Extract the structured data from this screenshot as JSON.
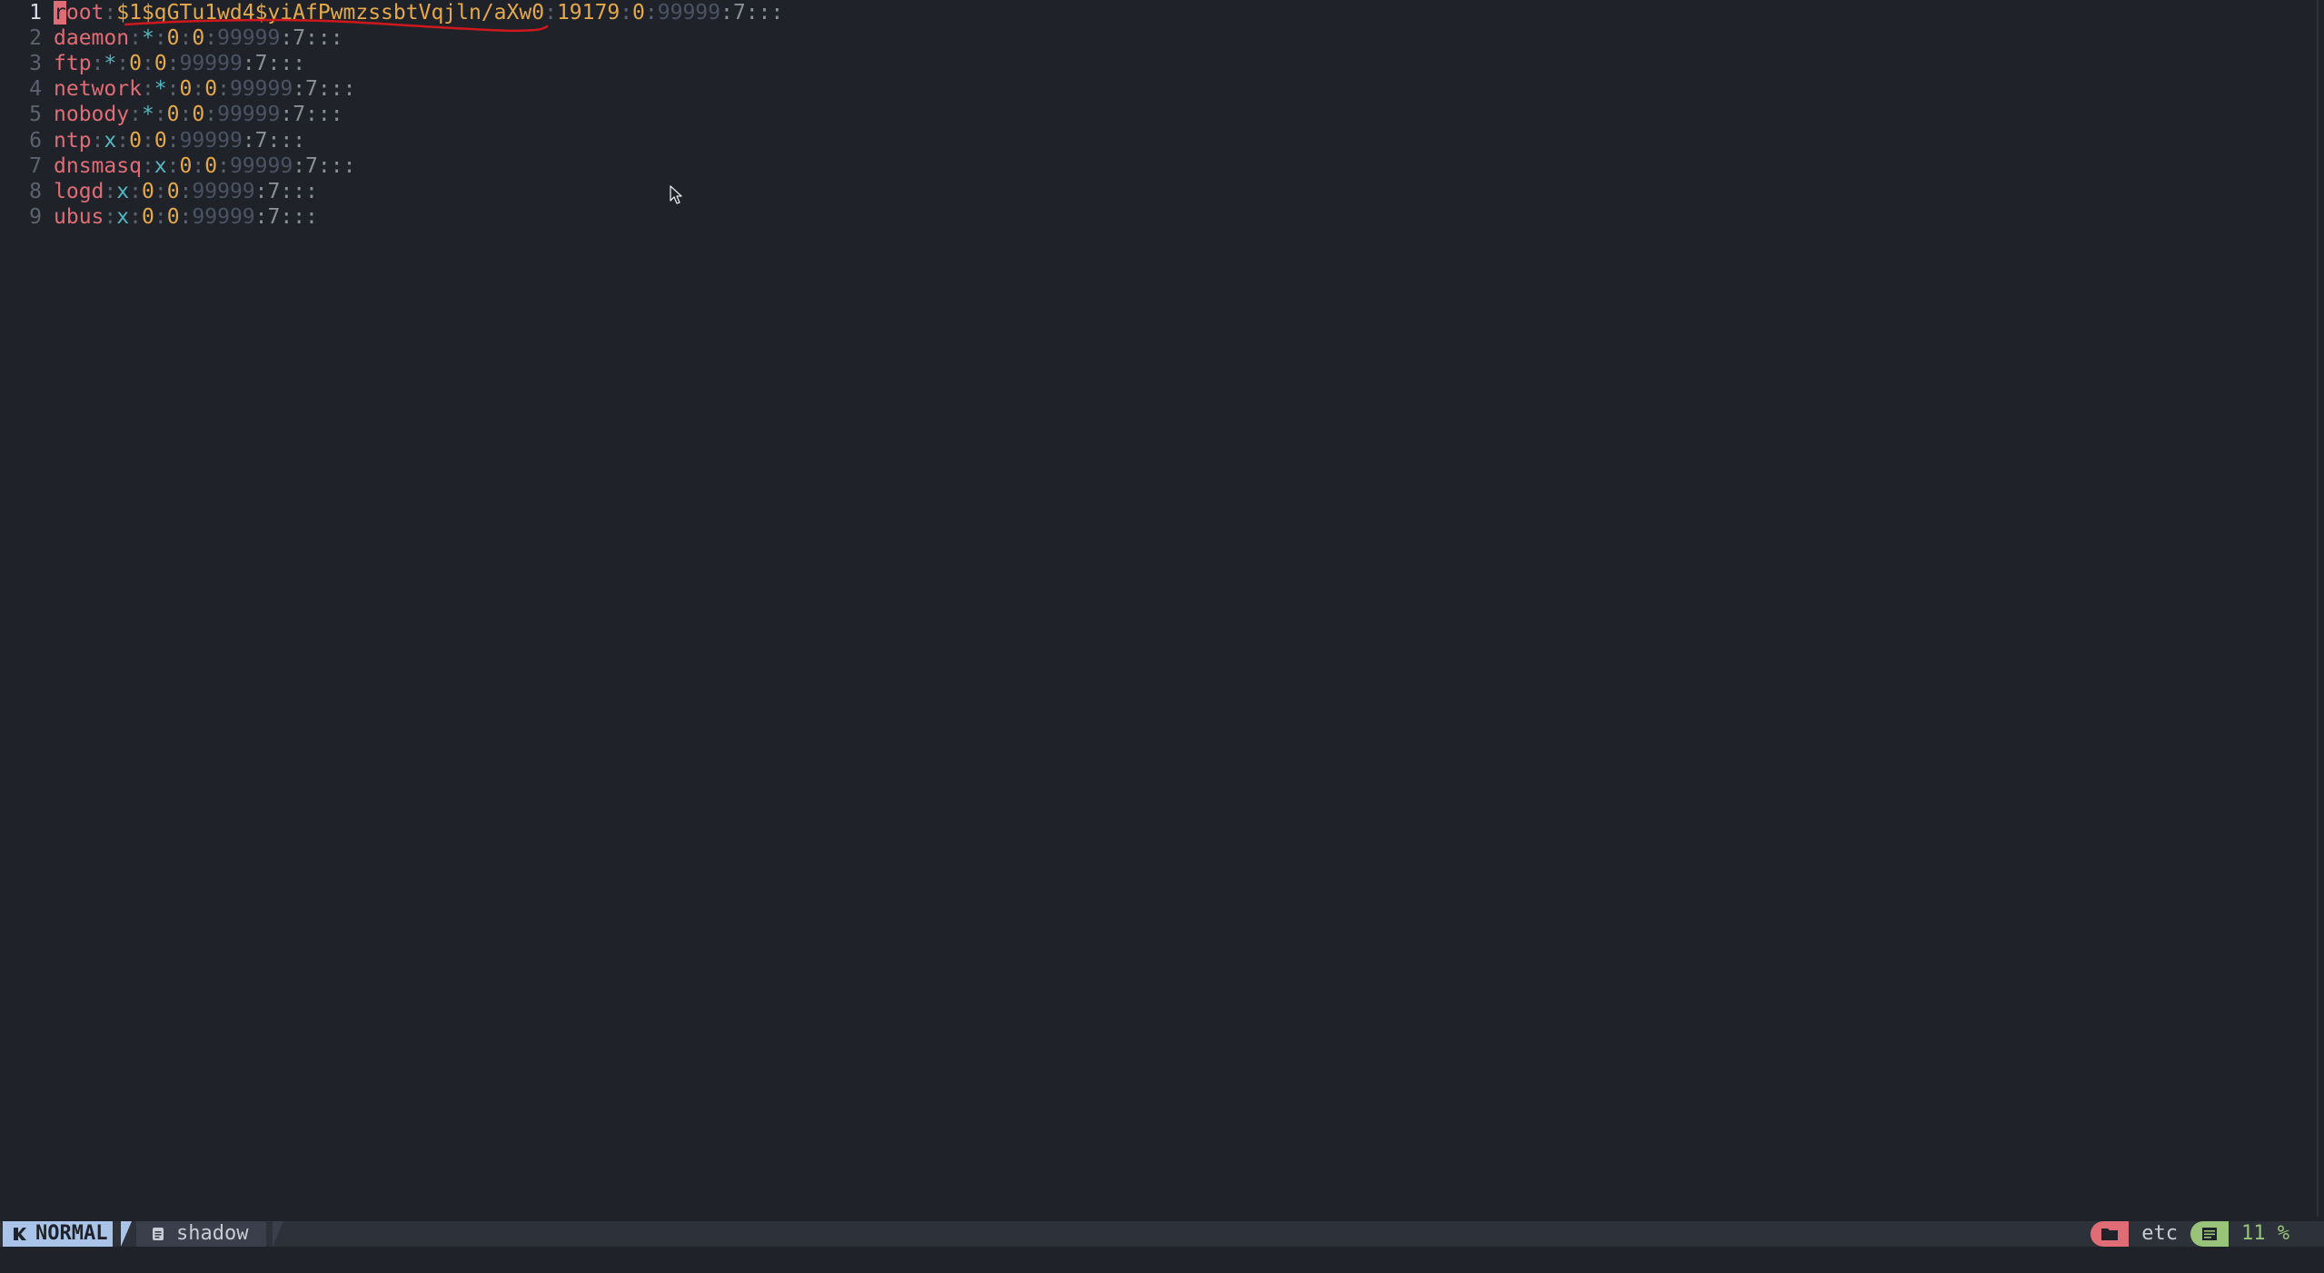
{
  "editor": {
    "lines": [
      {
        "num": "1",
        "segments": [
          {
            "text": "r",
            "color": "#e06c75",
            "cursor": true
          },
          {
            "text": "oot",
            "color": "#e06c75"
          },
          {
            "text": ":",
            "color": "#5c6370"
          },
          {
            "text": "$1$gGTu1wd4$yiAfPwmzssbtVqjln/aXw0",
            "color": "#e5a84b"
          },
          {
            "text": ":",
            "color": "#5c6370"
          },
          {
            "text": "19179",
            "color": "#e5a84b"
          },
          {
            "text": ":",
            "color": "#5c6370"
          },
          {
            "text": "0",
            "color": "#e5a84b"
          },
          {
            "text": ":",
            "color": "#5c6370"
          },
          {
            "text": "99999",
            "color": "#4b5263"
          },
          {
            "text": ":7:::",
            "color": "#8a909a"
          }
        ]
      },
      {
        "num": "2",
        "segments": [
          {
            "text": "daemon",
            "color": "#e06c75"
          },
          {
            "text": ":",
            "color": "#5c6370"
          },
          {
            "text": "*",
            "color": "#56b6c2"
          },
          {
            "text": ":",
            "color": "#5c6370"
          },
          {
            "text": "0",
            "color": "#e5a84b"
          },
          {
            "text": ":",
            "color": "#5c6370"
          },
          {
            "text": "0",
            "color": "#e5a84b"
          },
          {
            "text": ":",
            "color": "#5c6370"
          },
          {
            "text": "99999",
            "color": "#4b5263"
          },
          {
            "text": ":7:::",
            "color": "#8a909a"
          }
        ]
      },
      {
        "num": "3",
        "segments": [
          {
            "text": "ftp",
            "color": "#e06c75"
          },
          {
            "text": ":",
            "color": "#5c6370"
          },
          {
            "text": "*",
            "color": "#56b6c2"
          },
          {
            "text": ":",
            "color": "#5c6370"
          },
          {
            "text": "0",
            "color": "#e5a84b"
          },
          {
            "text": ":",
            "color": "#5c6370"
          },
          {
            "text": "0",
            "color": "#e5a84b"
          },
          {
            "text": ":",
            "color": "#5c6370"
          },
          {
            "text": "99999",
            "color": "#4b5263"
          },
          {
            "text": ":7:::",
            "color": "#8a909a"
          }
        ]
      },
      {
        "num": "4",
        "segments": [
          {
            "text": "network",
            "color": "#e06c75"
          },
          {
            "text": ":",
            "color": "#5c6370"
          },
          {
            "text": "*",
            "color": "#56b6c2"
          },
          {
            "text": ":",
            "color": "#5c6370"
          },
          {
            "text": "0",
            "color": "#e5a84b"
          },
          {
            "text": ":",
            "color": "#5c6370"
          },
          {
            "text": "0",
            "color": "#e5a84b"
          },
          {
            "text": ":",
            "color": "#5c6370"
          },
          {
            "text": "99999",
            "color": "#4b5263"
          },
          {
            "text": ":7:::",
            "color": "#8a909a"
          }
        ]
      },
      {
        "num": "5",
        "segments": [
          {
            "text": "nobody",
            "color": "#e06c75"
          },
          {
            "text": ":",
            "color": "#5c6370"
          },
          {
            "text": "*",
            "color": "#56b6c2"
          },
          {
            "text": ":",
            "color": "#5c6370"
          },
          {
            "text": "0",
            "color": "#e5a84b"
          },
          {
            "text": ":",
            "color": "#5c6370"
          },
          {
            "text": "0",
            "color": "#e5a84b"
          },
          {
            "text": ":",
            "color": "#5c6370"
          },
          {
            "text": "99999",
            "color": "#4b5263"
          },
          {
            "text": ":7:::",
            "color": "#8a909a"
          }
        ]
      },
      {
        "num": "6",
        "segments": [
          {
            "text": "ntp",
            "color": "#e06c75"
          },
          {
            "text": ":",
            "color": "#5c6370"
          },
          {
            "text": "x",
            "color": "#56b6c2"
          },
          {
            "text": ":",
            "color": "#5c6370"
          },
          {
            "text": "0",
            "color": "#e5a84b"
          },
          {
            "text": ":",
            "color": "#5c6370"
          },
          {
            "text": "0",
            "color": "#e5a84b"
          },
          {
            "text": ":",
            "color": "#5c6370"
          },
          {
            "text": "99999",
            "color": "#4b5263"
          },
          {
            "text": ":7:::",
            "color": "#8a909a"
          }
        ]
      },
      {
        "num": "7",
        "segments": [
          {
            "text": "dnsmasq",
            "color": "#e06c75"
          },
          {
            "text": ":",
            "color": "#5c6370"
          },
          {
            "text": "x",
            "color": "#56b6c2"
          },
          {
            "text": ":",
            "color": "#5c6370"
          },
          {
            "text": "0",
            "color": "#e5a84b"
          },
          {
            "text": ":",
            "color": "#5c6370"
          },
          {
            "text": "0",
            "color": "#e5a84b"
          },
          {
            "text": ":",
            "color": "#5c6370"
          },
          {
            "text": "99999",
            "color": "#4b5263"
          },
          {
            "text": ":7:::",
            "color": "#8a909a"
          }
        ]
      },
      {
        "num": "8",
        "segments": [
          {
            "text": "logd",
            "color": "#e06c75"
          },
          {
            "text": ":",
            "color": "#5c6370"
          },
          {
            "text": "x",
            "color": "#56b6c2"
          },
          {
            "text": ":",
            "color": "#5c6370"
          },
          {
            "text": "0",
            "color": "#e5a84b"
          },
          {
            "text": ":",
            "color": "#5c6370"
          },
          {
            "text": "0",
            "color": "#e5a84b"
          },
          {
            "text": ":",
            "color": "#5c6370"
          },
          {
            "text": "99999",
            "color": "#4b5263"
          },
          {
            "text": ":7:::",
            "color": "#8a909a"
          }
        ]
      },
      {
        "num": "9",
        "segments": [
          {
            "text": "ubus",
            "color": "#e06c75"
          },
          {
            "text": ":",
            "color": "#5c6370"
          },
          {
            "text": "x",
            "color": "#56b6c2"
          },
          {
            "text": ":",
            "color": "#5c6370"
          },
          {
            "text": "0",
            "color": "#e5a84b"
          },
          {
            "text": ":",
            "color": "#5c6370"
          },
          {
            "text": "0",
            "color": "#e5a84b"
          },
          {
            "text": ":",
            "color": "#5c6370"
          },
          {
            "text": "99999",
            "color": "#4b5263"
          },
          {
            "text": ":7:::",
            "color": "#8a909a"
          }
        ]
      }
    ]
  },
  "statusline": {
    "mode": "NORMAL",
    "mode_icon": "vim-logo-icon",
    "file_icon": "document-icon",
    "filename": "shadow",
    "dir_icon": "folder-icon",
    "directory": "etc",
    "progress_icon": "lines-icon",
    "progress": "11 %"
  },
  "colors": {
    "background": "#1f2329",
    "statusline_bg": "#2c313a",
    "mode_bg": "#a9c4e8",
    "dir_accent": "#e06c75",
    "progress_accent": "#98c379",
    "annotation_ink": "#d0181c"
  }
}
